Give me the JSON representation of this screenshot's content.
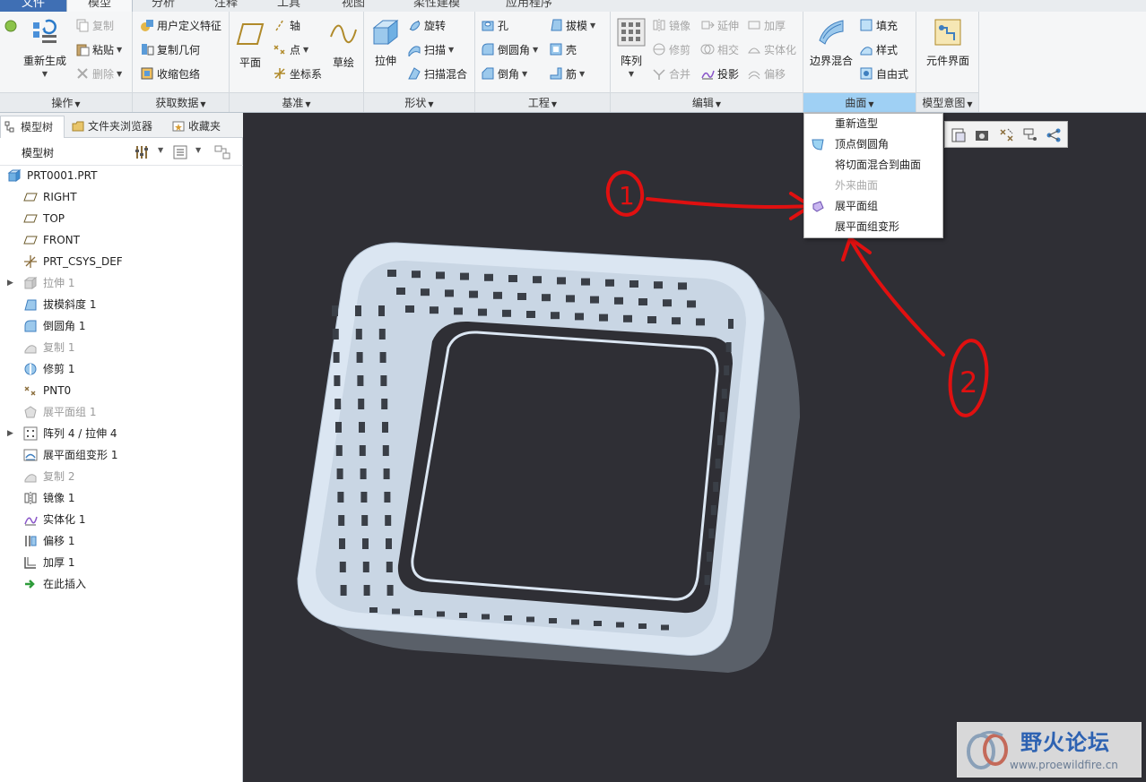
{
  "tabs": [
    "文件",
    "模型",
    "分析",
    "注释",
    "工具",
    "视图",
    "柔性建模",
    "应用程序"
  ],
  "ribbon": {
    "groups": {
      "ops": "操作",
      "getdata": "获取数据",
      "datum": "基准",
      "shape": "形状",
      "eng": "工程",
      "edit": "编辑",
      "surface": "曲面",
      "intent": "模型意图"
    },
    "ops": {
      "regen": "重新生成",
      "copy": "复制",
      "paste": "粘贴",
      "delete": "删除"
    },
    "getdata": {
      "udf": "用户定义特征",
      "copygeom": "复制几何",
      "shrinkwrap": "收缩包络"
    },
    "datum": {
      "plane": "平面",
      "axis": "轴",
      "point": "点",
      "csys": "坐标系",
      "sketch": "草绘"
    },
    "shape": {
      "extrude": "拉伸",
      "revolve": "旋转",
      "sweep": "扫描",
      "sweptblend": "扫描混合"
    },
    "eng": {
      "hole": "孔",
      "round": "倒圆角",
      "chamfer": "倒角",
      "draft": "拔模",
      "shell": "壳",
      "rib": "筋"
    },
    "edit": {
      "pattern": "阵列",
      "mirror": "镜像",
      "trim": "修剪",
      "merge": "合并",
      "extend": "延伸",
      "intersect": "相交",
      "project": "投影",
      "thicken": "加厚",
      "solidify": "实体化",
      "offset": "偏移"
    },
    "surface": {
      "boundary": "边界混合",
      "fill": "填充",
      "style": "样式",
      "freestyle": "自由式"
    },
    "intent": {
      "component": "元件界面"
    }
  },
  "panel": {
    "tabs": {
      "tree": "模型树",
      "folder": "文件夹浏览器",
      "fav": "收藏夹"
    },
    "title": "模型树",
    "items": [
      {
        "label": "PRT0001.PRT",
        "icon": "part-icon"
      },
      {
        "label": "RIGHT",
        "icon": "datum-plane-icon"
      },
      {
        "label": "TOP",
        "icon": "datum-plane-icon"
      },
      {
        "label": "FRONT",
        "icon": "datum-plane-icon"
      },
      {
        "label": "PRT_CSYS_DEF",
        "icon": "csys-icon"
      },
      {
        "label": "拉伸 1",
        "icon": "extrude-icon"
      },
      {
        "label": "拔模斜度 1",
        "icon": "draft-icon"
      },
      {
        "label": "倒圆角 1",
        "icon": "round-icon"
      },
      {
        "label": "复制 1",
        "icon": "copy-icon"
      },
      {
        "label": "修剪 1",
        "icon": "trim-icon"
      },
      {
        "label": "PNT0",
        "icon": "datum-point-icon"
      },
      {
        "label": "展平面组 1",
        "icon": "flatten-quilt-icon"
      },
      {
        "label": "阵列 4 / 拉伸 4",
        "icon": "pattern-icon"
      },
      {
        "label": "展平面组变形 1",
        "icon": "flatten-deform-icon"
      },
      {
        "label": "复制 2",
        "icon": "copy-icon"
      },
      {
        "label": "镜像 1",
        "icon": "mirror-icon"
      },
      {
        "label": "实体化 1",
        "icon": "solidify-icon"
      },
      {
        "label": "偏移 1",
        "icon": "offset-icon"
      },
      {
        "label": "加厚 1",
        "icon": "thicken-icon"
      },
      {
        "label": "在此插入",
        "icon": "insert-here-icon"
      }
    ]
  },
  "surface_menu": {
    "items": [
      {
        "label": "重新造型"
      },
      {
        "label": "顶点倒圆角"
      },
      {
        "label": "将切面混合到曲面"
      },
      {
        "label": "外来曲面"
      },
      {
        "label": "展平面组"
      },
      {
        "label": "展平面组变形"
      }
    ]
  },
  "annotations": {
    "one": "1",
    "two": "2"
  },
  "watermark": {
    "title": "野火论坛",
    "url": "www.proewildfire.cn"
  },
  "colors": {
    "accent": "#3f6fb4",
    "highlight": "#9fd0f4",
    "background": "#2f2f35",
    "model": "#d9e6f2",
    "annotation": "#e01010"
  }
}
